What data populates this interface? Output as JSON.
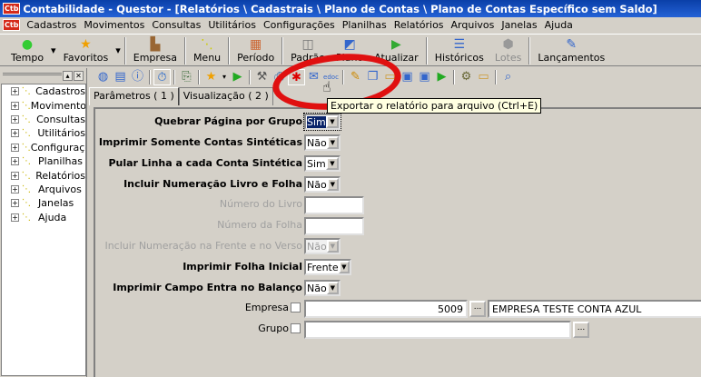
{
  "window": {
    "title": "Contabilidade - Questor - [Relatórios \\ Cadastrais \\ Plano de Contas \\ Plano de Contas Específico sem Saldo]",
    "app_badge": "Ctb"
  },
  "menu": [
    "Cadastros",
    "Movimentos",
    "Consultas",
    "Utilitários",
    "Configurações",
    "Planilhas",
    "Relatórios",
    "Arquivos",
    "Janelas",
    "Ajuda"
  ],
  "toolbar": [
    {
      "label": "Tempo",
      "icon": "clock-icon"
    },
    {
      "label": "Favoritos",
      "icon": "star-icon"
    },
    {
      "label": "Empresa",
      "icon": "company-icon"
    },
    {
      "label": "Menu",
      "icon": "menu-icon"
    },
    {
      "label": "Período",
      "icon": "calendar-icon"
    },
    {
      "label": "Padrão",
      "icon": "default-icon"
    },
    {
      "label": "Plano",
      "icon": "plan-icon"
    },
    {
      "label": "Atualizar",
      "icon": "refresh-icon"
    },
    {
      "label": "Históricos",
      "icon": "history-icon"
    },
    {
      "label": "Lotes",
      "icon": "batch-icon",
      "disabled": true
    },
    {
      "label": "Lançamentos",
      "icon": "entries-icon"
    }
  ],
  "tree": [
    "Cadastros",
    "Movimentos",
    "Consultas",
    "Utilitários",
    "Configurações",
    "Planilhas",
    "Relatórios",
    "Arquivos",
    "Janelas",
    "Ajuda"
  ],
  "tabs": [
    "Parâmetros ( 1 )",
    "Visualização ( 2 )"
  ],
  "tooltip": "Exportar o relatório para arquivo (Ctrl+E)",
  "form": {
    "quebrar": {
      "label": "Quebrar Página por Grupo",
      "value": "Sim"
    },
    "somente": {
      "label": "Imprimir Somente Contas Sintéticas",
      "value": "Não"
    },
    "pular": {
      "label": "Pular Linha a cada Conta Sintética",
      "value": "Sim"
    },
    "incluir": {
      "label": "Incluir Numeração Livro e Folha",
      "value": "Não"
    },
    "livro": {
      "label": "Número do Livro",
      "value": ""
    },
    "folha": {
      "label": "Número da Folha",
      "value": ""
    },
    "frente_verso": {
      "label": "Incluir Numeração na Frente e no Verso",
      "value": "Não"
    },
    "folha_inicial": {
      "label": "Imprimir Folha Inicial",
      "value": "Frente"
    },
    "campo_entra": {
      "label": "Imprimir Campo Entra no Balanço",
      "value": "Não"
    },
    "empresa": {
      "label": "Empresa",
      "code": "5009",
      "name": "EMPRESA TESTE CONTA AZUL"
    },
    "grupo": {
      "label": "Grupo",
      "value": ""
    }
  },
  "colors": {
    "titlebar": "#0a3fa8",
    "highlight_ellipse": "#e01010",
    "tooltip_bg": "#ffffe1"
  }
}
